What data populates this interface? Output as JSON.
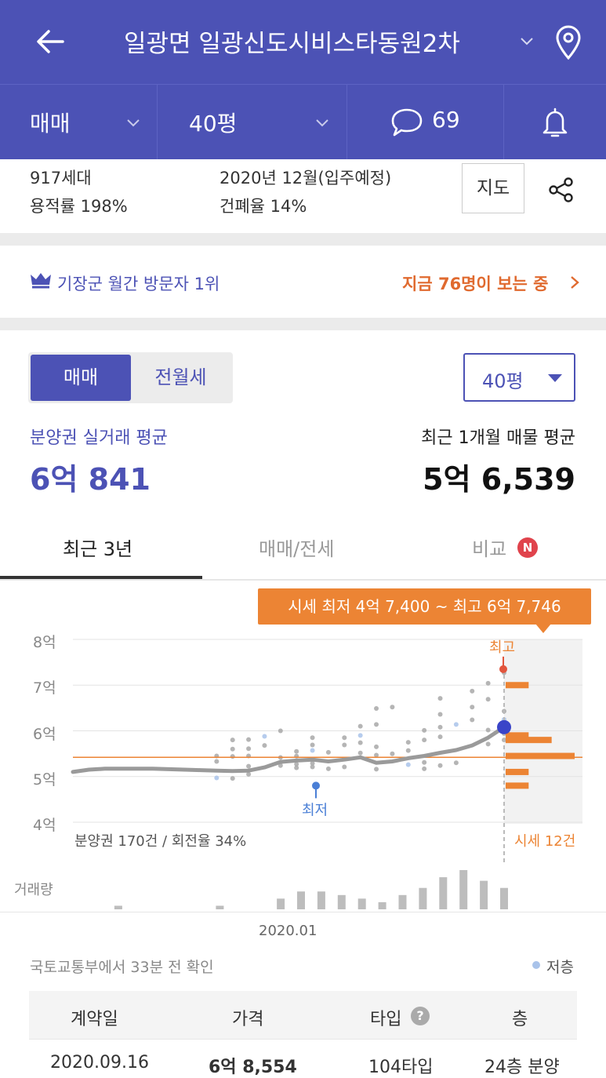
{
  "header": {
    "title": "일광면 일광신도시비스타동원2차",
    "icons": [
      "back-arrow-icon",
      "chevron-down-icon",
      "location-pin-icon"
    ]
  },
  "subbar": {
    "trade_type": "매매",
    "size": "40평",
    "comments_count": "69",
    "icons": [
      "chevron-down-icon",
      "speech-bubble-icon",
      "bell-icon"
    ]
  },
  "info": {
    "households": "917세대",
    "floor_area_ratio": "용적률 198%",
    "move_in": "2020년 12월(입주예정)",
    "coverage_ratio": "건폐율 14%",
    "map_button": "지도"
  },
  "visit": {
    "rank_text": "기장군 월간 방문자 1위",
    "viewers_text": "지금 76명이 보는 중"
  },
  "price_panel": {
    "segment_active": "매매",
    "segment_inactive": "전월세",
    "size_select": "40평",
    "left_label": "분양권 실거래 평균",
    "left_value": "6억 841",
    "right_label": "최근 1개월 매물 평균",
    "right_value": "5억 6,539"
  },
  "tabs": {
    "recent": "최근 3년",
    "trade_rent": "매매/전세",
    "compare": "비교",
    "new_badge": "N"
  },
  "chart": {
    "callout": "시세 최저 4억 7,400 ~ 최고 6억 7,746",
    "y_labels": [
      "8억",
      "7억",
      "6억",
      "5억",
      "4억"
    ],
    "high_label": "최고",
    "low_label": "최저",
    "stats_left": "분양권 170건 / 회전율 34%",
    "stats_right": "시세 12건",
    "volume_label": "거래량",
    "x_label": "2020.01",
    "colors": {
      "line": "#9a9a9a",
      "orange": "#ec8434",
      "blue": "#3a44c8",
      "low_dot": "#4a7fd6",
      "high_dot": "#e2553d",
      "dots": "#a8a8a8",
      "volume": "#bdbdbd"
    }
  },
  "chart_data": {
    "type": "line",
    "ylim": [
      4,
      8
    ],
    "y_unit": "억",
    "trend": [
      5.1,
      5.15,
      5.17,
      5.17,
      5.17,
      5.17,
      5.16,
      5.15,
      5.14,
      5.13,
      5.12,
      5.13,
      5.2,
      5.32,
      5.35,
      5.37,
      5.33,
      5.37,
      5.42,
      5.3,
      5.33,
      5.4,
      5.45,
      5.52,
      5.58,
      5.68,
      5.85,
      6.08
    ],
    "current_value": 6.08,
    "high_value": 7.35,
    "low_value": 4.8,
    "reference_line": 5.42,
    "listing_histogram": [
      {
        "price": 7.0,
        "count": 2
      },
      {
        "price": 5.9,
        "count": 2
      },
      {
        "price": 5.8,
        "count": 4
      },
      {
        "price": 5.45,
        "count": 6
      },
      {
        "price": 5.1,
        "count": 2
      },
      {
        "price": 4.8,
        "count": 2
      }
    ],
    "volume": [
      0,
      1,
      0,
      0,
      0,
      0,
      1,
      0,
      0,
      3,
      5,
      5,
      4,
      3,
      2,
      4,
      6,
      9,
      11,
      8,
      6
    ]
  },
  "footer": {
    "source": "국토교통부에서 33분 전 확인",
    "legend_low": "저층"
  },
  "table": {
    "headers": [
      "계약일",
      "가격",
      "타입",
      "층"
    ],
    "row": {
      "date": "2020.09.16",
      "price": "6억 8,554",
      "type": "104타입",
      "floor": "24층 분양"
    }
  }
}
